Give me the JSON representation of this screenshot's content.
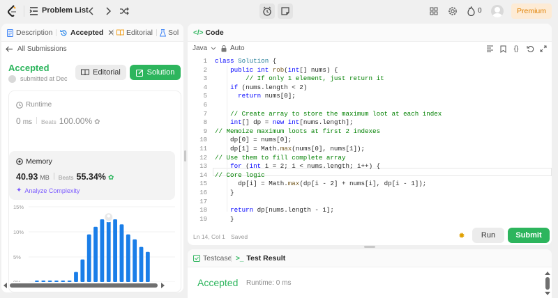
{
  "topbar": {
    "problem_list_label": "Problem List",
    "streak_count": "0",
    "premium_label": "Premium"
  },
  "left_panel": {
    "tabs": [
      {
        "label": "Description"
      },
      {
        "label": "Accepted"
      },
      {
        "label": "Editorial"
      },
      {
        "label": "Sol"
      }
    ],
    "back_label": "All Submissions",
    "status": "Accepted",
    "submitted_text": "submitted at Dec",
    "editorial_button": "Editorial",
    "solution_button": "Solution",
    "runtime": {
      "title": "Runtime",
      "value": "0",
      "unit": "ms",
      "beats_label": "Beats",
      "beats_value": "100.00%"
    },
    "memory": {
      "title": "Memory",
      "value": "40.93",
      "unit": "MB",
      "beats_label": "Beats",
      "beats_value": "55.34%",
      "analyze_label": "Analyze Complexity"
    }
  },
  "chart_data": {
    "type": "bar",
    "y_ticks": [
      "15%",
      "10%",
      "5%",
      "0%"
    ],
    "ylim": [
      0,
      15
    ],
    "values": [
      0.3,
      0.3,
      0.3,
      0.3,
      0.3,
      0.3,
      2.0,
      4.5,
      9.5,
      11.0,
      12.5,
      13.5,
      12.5,
      11.5,
      9.5,
      8.5,
      7.0,
      6.0
    ],
    "highlight_index": 11,
    "bar_color": "#1a7ee8"
  },
  "code_panel": {
    "title": "Code",
    "language": "Java",
    "mode": "Auto",
    "cursor_position": "Ln 14, Col 1",
    "save_status": "Saved",
    "run_label": "Run",
    "submit_label": "Submit"
  },
  "code_lines": [
    {
      "n": "1",
      "t": "class Solution {"
    },
    {
      "n": "2",
      "t": "    public int rob(int[] nums) {"
    },
    {
      "n": "3",
      "t": "        // If only 1 element, just return it"
    },
    {
      "n": "4",
      "t": "    if (nums.length < 2)"
    },
    {
      "n": "5",
      "t": "      return nums[0];"
    },
    {
      "n": "6",
      "t": ""
    },
    {
      "n": "7",
      "t": "    // Create array to store the maximum loot at each index"
    },
    {
      "n": "8",
      "t": "    int[] dp = new int[nums.length];"
    },
    {
      "n": "9",
      "t": "// Memoize maximum loots at first 2 indexes"
    },
    {
      "n": "10",
      "t": "    dp[0] = nums[0];"
    },
    {
      "n": "11",
      "t": "    dp[1] = Math.max(nums[0], nums[1]);"
    },
    {
      "n": "12",
      "t": "// Use them to fill complete array"
    },
    {
      "n": "13",
      "t": "    for (int i = 2; i < nums.length; i++) {"
    },
    {
      "n": "14",
      "t": "// Core logic"
    },
    {
      "n": "15",
      "t": "      dp[i] = Math.max(dp[i - 2] + nums[i], dp[i - 1]);"
    },
    {
      "n": "16",
      "t": "    }"
    },
    {
      "n": "17",
      "t": ""
    },
    {
      "n": "18",
      "t": "    return dp[nums.length - 1];"
    },
    {
      "n": "19",
      "t": "    }"
    }
  ],
  "test_panel": {
    "testcase_tab": "Testcase",
    "result_tab": "Test Result",
    "status": "Accepted",
    "runtime_text": "Runtime: 0 ms"
  }
}
